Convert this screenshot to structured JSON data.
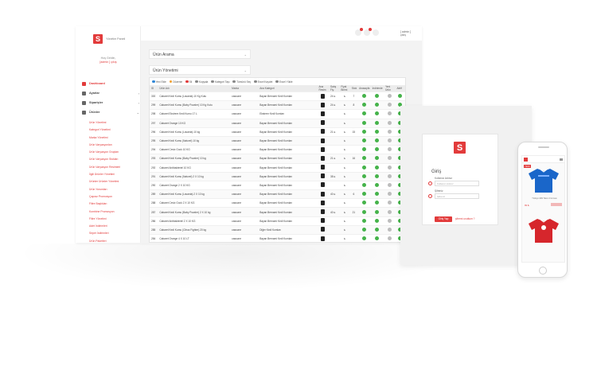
{
  "colors": {
    "accent": "#e23b3b",
    "success": "#45b34a",
    "muted": "#bdbdbd"
  },
  "brand": {
    "name": "Yönetim Paneli",
    "logo_letter": "S"
  },
  "greeting": {
    "line1": "Hoş Geldin,",
    "line2": "[admin ] çıkış"
  },
  "nav": [
    {
      "label": "Dashboard",
      "icon": "dashboard-icon",
      "active": true,
      "chevron": ""
    },
    {
      "label": "Ayarlar",
      "icon": "gear-icon",
      "active": false,
      "chevron": "›"
    },
    {
      "label": "Siparişler",
      "icon": "orders-icon",
      "active": false,
      "chevron": "›"
    },
    {
      "label": "Ürünler",
      "icon": "products-icon",
      "active": false,
      "chevron": "⌄"
    }
  ],
  "subnav": [
    "Ürün Yönetimi",
    "Kategori Yönetimi",
    "Marka Yönetimi",
    "Ürün Varyasyonları",
    "Ürün Varyasyon Grupları",
    "Ürün Varyasyon Stokları",
    "Ürün Varyasyon Resimleri",
    "İlgili Ürünler Yönetimi",
    "Ürünler Ürünler Yönetimi",
    "Ürün Yorumları",
    "Çapraz Promosyon",
    "Filtre Başlıkları",
    "Kombine Promosyon",
    "Filtre Yönetimi",
    "Adet İndirimleri",
    "Sepet İndirimleri",
    "Ürün Paketleri"
  ],
  "topbar": {
    "user": "[ admin ]",
    "user_sub": "çıkış"
  },
  "panels": {
    "search": "Ürün Arama",
    "management": "Ürün Yönetimi"
  },
  "toolbar": [
    {
      "label": "Yeni Ekle",
      "color": "#2f86d6"
    },
    {
      "label": "Düzenle",
      "color": "#f0a030"
    },
    {
      "label": "Sil",
      "color": "#e23b3b"
    },
    {
      "label": "Kopyala",
      "color": "#888888"
    },
    {
      "label": "Kategori Taşı",
      "color": "#888888"
    },
    {
      "label": "Tümünü Seç",
      "color": "#888888"
    },
    {
      "label": "Excel Kaydet",
      "color": "#888888"
    },
    {
      "label": "Excel Yükle",
      "color": "#888888"
    }
  ],
  "table": {
    "columns": [
      "ID",
      "Ürün Adı",
      "Marka",
      "Ana Kategori",
      "Ana Resim",
      "Satış Fiy.",
      "Fiyat Birimi",
      "Stok",
      "Anasayfa",
      "İndirimde",
      "Yeni Ürün",
      "Aktif"
    ],
    "rows": [
      {
        "id": "300",
        "name": "Cabaret Kedi Kumu (Lavanta) 10 Kg Kutu",
        "brand": "cassone",
        "cat": "Bayan Bernami Kedi Kumları",
        "thumb": true,
        "price": "24 ₺",
        "unit": "₺",
        "stock": "7",
        "flags": [
          "g",
          "g",
          "x",
          "g"
        ]
      },
      {
        "id": "299",
        "name": "Cabaret Kedi Kumu (Baby Powder) 10 Kg Kutu",
        "brand": "cassone",
        "cat": "Bayan Bernami Kedi Kumları",
        "thumb": true,
        "price": "24 ₺",
        "unit": "₺",
        "stock": "8",
        "flags": [
          "g",
          "g",
          "x",
          "g"
        ]
      },
      {
        "id": "298",
        "name": "Cabaret Ekstrem Kedi Kumu 17 L",
        "brand": "cassone",
        "cat": "Ekstrem Kedi Kumları",
        "thumb": true,
        "price": "",
        "unit": "₺",
        "stock": "",
        "flags": [
          "g",
          "g",
          "x",
          "g"
        ]
      },
      {
        "id": "297",
        "name": "Cabaret Orange 10 KG",
        "brand": "cassone",
        "cat": "Bayan Bernami Kedi Kumları",
        "thumb": true,
        "price": "",
        "unit": "₺",
        "stock": "",
        "flags": [
          "g",
          "g",
          "x",
          "g"
        ]
      },
      {
        "id": "296",
        "name": "Cabaret Kedi Kumu (Lavanta) 10 kg",
        "brand": "cassone",
        "cat": "Bayan Bernami Kedi Kumları",
        "thumb": true,
        "price": "21 ₺",
        "unit": "₺",
        "stock": "15",
        "flags": [
          "g",
          "g",
          "x",
          "g"
        ]
      },
      {
        "id": "295",
        "name": "Cabaret Kedi Kumu (Naturel) 10 kg",
        "brand": "cassone",
        "cat": "Bayan Bernami Kedi Kumları",
        "thumb": true,
        "price": "",
        "unit": "₺",
        "stock": "",
        "flags": [
          "g",
          "g",
          "x",
          "g"
        ]
      },
      {
        "id": "294",
        "name": "Cabaret Ceviz Gıcık 10 KG",
        "brand": "cassone",
        "cat": "Bayan Bernami Kedi Kumları",
        "thumb": true,
        "price": "",
        "unit": "₺",
        "stock": "",
        "flags": [
          "g",
          "g",
          "x",
          "g"
        ]
      },
      {
        "id": "293",
        "name": "Cabaret Kedi Kumu (Baby Powder) 10 kg",
        "brand": "cassone",
        "cat": "Bayan Bernami Kedi Kumları",
        "thumb": true,
        "price": "21 ₺",
        "unit": "₺",
        "stock": "16",
        "flags": [
          "g",
          "g",
          "x",
          "g"
        ]
      },
      {
        "id": "292",
        "name": "Cabaret Antibakteriel 10 KG",
        "brand": "cassone",
        "cat": "Bayan Bernami Kedi Kumları",
        "thumb": true,
        "price": "",
        "unit": "₺",
        "stock": "",
        "flags": [
          "g",
          "g",
          "x",
          "g"
        ]
      },
      {
        "id": "291",
        "name": "Cabaret Kedi Kumu (Naturel) 2 X 10 kg",
        "brand": "cassone",
        "cat": "Bayan Bernami Kedi Kumları",
        "thumb": true,
        "price": "38 ₺",
        "unit": "₺",
        "stock": "",
        "flags": [
          "g",
          "g",
          "x",
          "g"
        ]
      },
      {
        "id": "290",
        "name": "Cabaret Orange 2 X 10 KG",
        "brand": "cassone",
        "cat": "Bayan Bernami Kedi Kumları",
        "thumb": true,
        "price": "",
        "unit": "₺",
        "stock": "",
        "flags": [
          "g",
          "g",
          "x",
          "g"
        ]
      },
      {
        "id": "289",
        "name": "Cabaret Kedi Kumu (Lavanta) 2 X 10 kg",
        "brand": "cassone",
        "cat": "Bayan Bernami Kedi Kumları",
        "thumb": true,
        "price": "40 ₺",
        "unit": "₺",
        "stock": "6",
        "flags": [
          "g",
          "g",
          "x",
          "g"
        ]
      },
      {
        "id": "288",
        "name": "Cabaret Ceviz Gıcık 2 X 10 KG",
        "brand": "cassone",
        "cat": "Bayan Bernami Kedi Kumları",
        "thumb": true,
        "price": "",
        "unit": "₺",
        "stock": "",
        "flags": [
          "g",
          "g",
          "x",
          "g"
        ]
      },
      {
        "id": "287",
        "name": "Cabaret Kedi Kumu (Baby Powder) 2 X 10 kg",
        "brand": "cassone",
        "cat": "Bayan Bernami Kedi Kumları",
        "thumb": true,
        "price": "40 ₺",
        "unit": "₺",
        "stock": "21",
        "flags": [
          "g",
          "g",
          "x",
          "g"
        ]
      },
      {
        "id": "286",
        "name": "Cabaret Antibakteriel 2 X 10 KG",
        "brand": "cassone",
        "cat": "Bayan Bernami Kedi Kumları",
        "thumb": true,
        "price": "",
        "unit": "₺",
        "stock": "",
        "flags": [
          "g",
          "g",
          "x",
          "g"
        ]
      },
      {
        "id": "285",
        "name": "Cabaret Kedi Kumu (Citrus Fighter) 20 kg",
        "brand": "cassone",
        "cat": "Diğer Kedi Kumları",
        "thumb": true,
        "price": "",
        "unit": "₺",
        "stock": "",
        "flags": [
          "g",
          "g",
          "x",
          "g"
        ]
      },
      {
        "id": "284",
        "name": "Cabaret Orange 4 X 10 LT",
        "brand": "cassone",
        "cat": "Bayan Bernami Kedi Kumları",
        "thumb": true,
        "price": "",
        "unit": "₺",
        "stock": "",
        "flags": [
          "g",
          "g",
          "x",
          "g"
        ]
      }
    ]
  },
  "login": {
    "logo_letter": "S",
    "title": "Giriş",
    "user_label": "Kullanıcı Adınız",
    "user_placeholder": "Kullanıcı Adınız",
    "pass_label": "Şifreniz",
    "pass_placeholder": "Şifreniz",
    "button": "Giriş Yap",
    "forgot": "şifremi unuttum ?"
  },
  "phone": {
    "tag": "YENİ",
    "product_name": "Türkiye Milli Takım Forması",
    "price": "99 ₺"
  }
}
